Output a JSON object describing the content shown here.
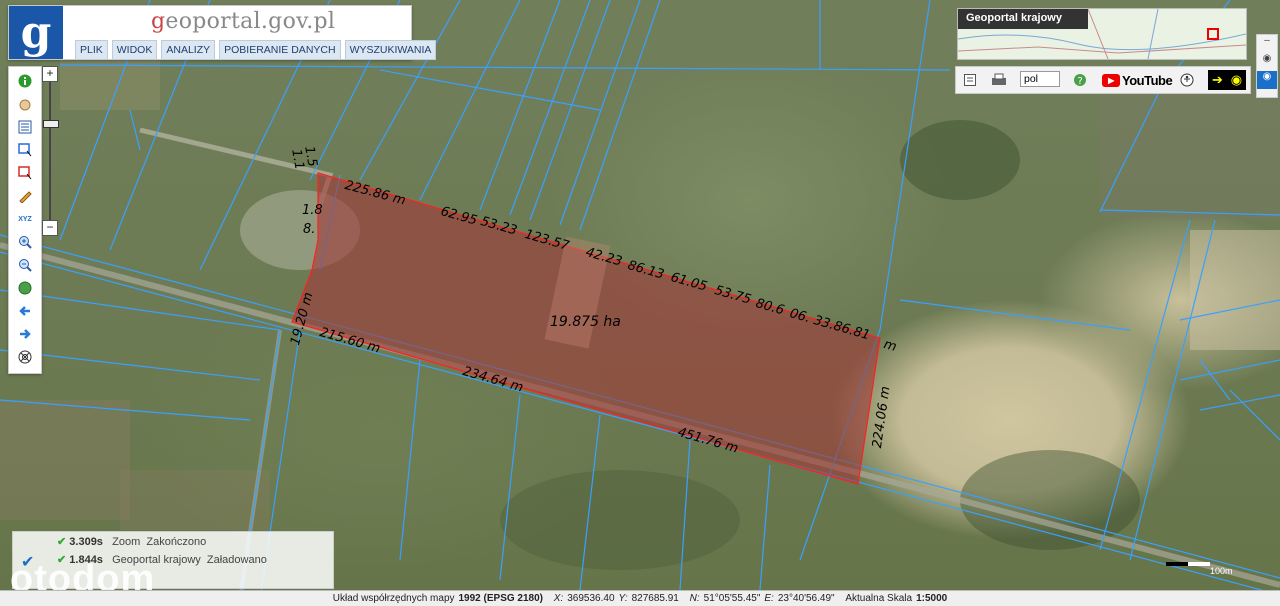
{
  "header": {
    "site_title_g": "g",
    "site_title_rest": "eoportal.gov.pl",
    "logo_letter": "g",
    "menu": [
      {
        "label": "PLIK"
      },
      {
        "label": "WIDOK"
      },
      {
        "label": "ANALIZY"
      },
      {
        "label": "POBIERANIE DANYCH"
      },
      {
        "label": "WYSZUKIWANIA"
      }
    ]
  },
  "left_tools": [
    {
      "icon": "info-icon"
    },
    {
      "icon": "pan-hand-icon"
    },
    {
      "icon": "layers-list-icon"
    },
    {
      "icon": "select-area-icon"
    },
    {
      "icon": "deselect-area-icon"
    },
    {
      "icon": "pencil-icon"
    },
    {
      "icon": "xyz-coordinates-icon"
    },
    {
      "icon": "zoom-in-icon"
    },
    {
      "icon": "zoom-out-icon"
    },
    {
      "icon": "globe-icon"
    },
    {
      "icon": "back-arrow-icon"
    },
    {
      "icon": "forward-arrow-icon"
    },
    {
      "icon": "help-wheel-icon"
    }
  ],
  "zoom": {
    "plus": "+",
    "minus": "−"
  },
  "minimap": {
    "title": "Geoportal krajowy"
  },
  "right_toolbar": {
    "language": "pol",
    "youtube_label": "YouTube",
    "icons": [
      "legend-icon",
      "print-icon",
      "help-icon",
      "accessibility-icon",
      "visibility-eye-icon"
    ]
  },
  "parcel": {
    "area": "19.875 ha",
    "edge_labels": [
      "225.86 m",
      "62.95",
      "53.23",
      "123.57",
      "42.23",
      "86.13",
      "61.05",
      "53.75",
      "80.6",
      "06.",
      "33.86.81",
      "m",
      "224.06 m",
      "451.76 m",
      "234.64 m",
      "215.60 m",
      "19.20 m",
      "1.5",
      "1.1",
      "1.8",
      "8."
    ]
  },
  "log": {
    "rows": [
      {
        "time": "3.309s",
        "source": "Zoom",
        "state": "Zakończono"
      },
      {
        "time": "1.844s",
        "source": "Geoportal krajowy",
        "state": "Załadowano"
      }
    ]
  },
  "watermark": "otodom",
  "status": {
    "prefix": "Układ współrzędnych mapy",
    "crs": "1992 (EPSG 2180)",
    "x_label": "X:",
    "x_value": "369536.40",
    "y_label": "Y:",
    "y_value": "827685.91",
    "n_label": "N:",
    "n_value": "51°05'55.45\"",
    "e_label": "E:",
    "e_value": "23°40'56.49\"",
    "scale_label": "Aktualna Skala",
    "scale_value": "1:5000"
  },
  "scale_bar": {
    "text": "100m"
  },
  "colors": {
    "parcel_fill": "#a23a3a",
    "parcel_stroke": "#ff2020",
    "boundary": "#3aa0ff",
    "accent": "#1b57a9"
  }
}
